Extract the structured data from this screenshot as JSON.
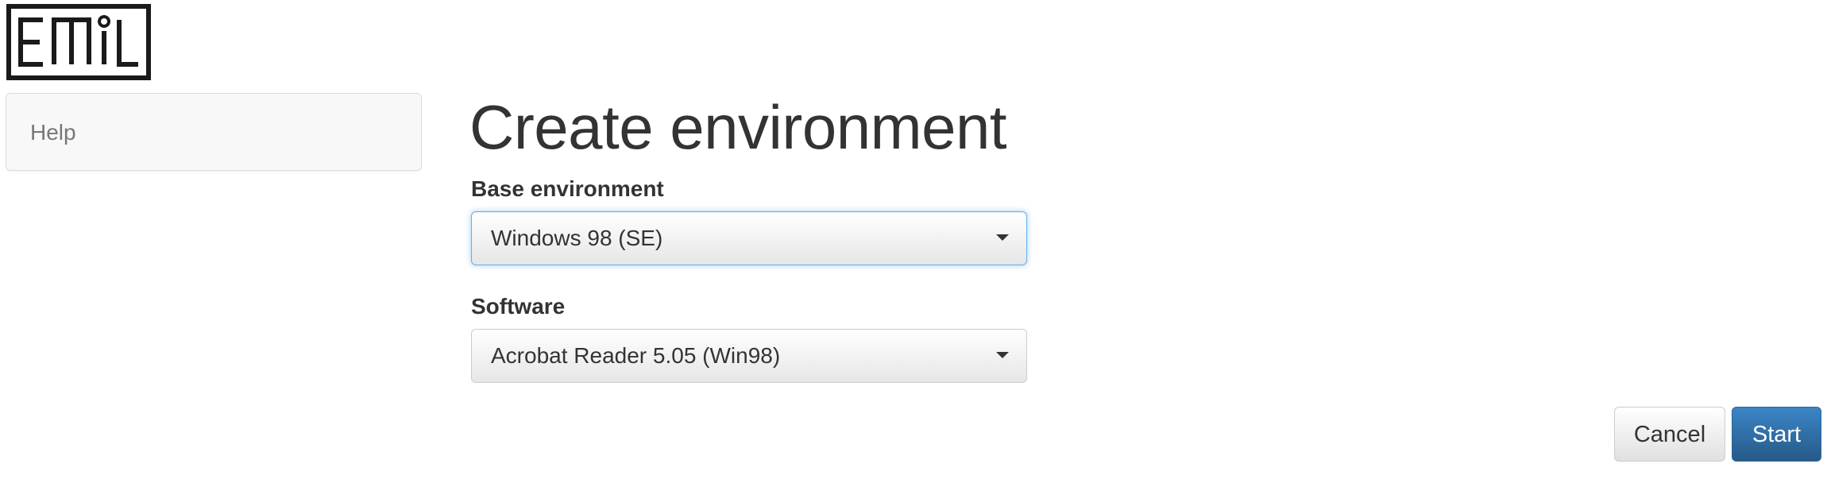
{
  "brand": {
    "logo_text": "EMiL"
  },
  "sidebar": {
    "items": [
      {
        "label": "Help"
      }
    ]
  },
  "main": {
    "title": "Create environment",
    "base_environment": {
      "label": "Base environment",
      "selected": "Windows 98 (SE)"
    },
    "software": {
      "label": "Software",
      "selected": "Acrobat Reader 5.05 (Win98)"
    }
  },
  "actions": {
    "cancel_label": "Cancel",
    "start_label": "Start"
  },
  "colors": {
    "primary": "#286090",
    "focus_ring": "#66afe9",
    "text": "#333333",
    "muted_text": "#777777"
  },
  "icons": {
    "select_caret": "chevron-down-icon"
  }
}
